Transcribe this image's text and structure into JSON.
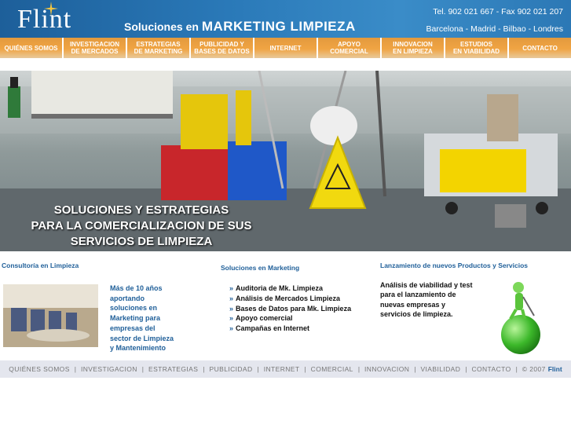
{
  "header": {
    "logo": "Flint",
    "tagline_prefix": "Soluciones en",
    "tagline_main": "MARKETING LIMPIEZA",
    "phone": "Tel. 902 021 667  -  Fax 902 021 207",
    "cities": "Barcelona - Madrid - Bilbao - Londres"
  },
  "nav": [
    "QUIÉNES SOMOS",
    "INVESTIGACION\nDE MERCADOS",
    "ESTRATEGIAS\nDE MARKETING",
    "PUBLICIDAD Y\nBASES DE DATOS",
    "INTERNET",
    "APOYO\nCOMERCIAL",
    "INNOVACION\nEN LIMPIEZA",
    "ESTUDIOS\nEN VIABILIDAD",
    "CONTACTO"
  ],
  "hero": {
    "text": "SOLUCIONES Y ESTRATEGIAS\nPARA LA COMERCIALIZACION DE SUS\nSERVICIOS DE LIMPIEZA"
  },
  "consultoria": {
    "title": "Consultoría en Limpieza",
    "text": "Más de 10 años\naportando\nsoluciones en\nMarketing para\nempresas del\nsector de Limpieza\ny Mantenimiento"
  },
  "soluciones": {
    "title": "Soluciones en Marketing",
    "items": [
      "Auditoria de Mk. Limpieza",
      "Análisis de Mercados Limpieza",
      "Bases de Datos para Mk. Limpieza",
      "Apoyo comercial",
      "Campañas en Internet"
    ]
  },
  "lanzamiento": {
    "title": "Lanzamiento de nuevos Productos y Servicios",
    "text": "Análisis de viabilidad y test\npara el lanzamiento de\nnuevas empresas y\nservicios de limpieza."
  },
  "footer": {
    "links": [
      "QUIÉNES SOMOS",
      "INVESTIGACION",
      "ESTRATEGIAS",
      "PUBLICIDAD",
      "INTERNET",
      "COMERCIAL",
      "INNOVACION",
      "VIABILIDAD",
      "CONTACTO"
    ],
    "copyright": "© 2007",
    "brand": "Flint"
  },
  "colors": {
    "header_blue": "#2a79b8",
    "nav_orange": "#f0a443",
    "title_blue": "#1f5f99",
    "footer_bg": "#e4e6ee"
  }
}
